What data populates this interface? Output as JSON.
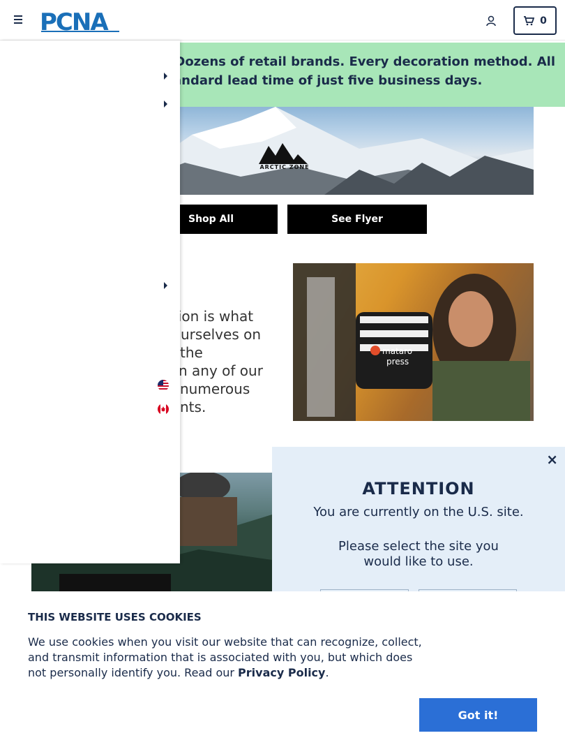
{
  "header": {
    "logo_text": "PCNA",
    "cart_count": "0"
  },
  "announcement": {
    "line1": "roducts. Dozens of retail brands. Every decoration method. All",
    "line2": "andard lead time of just five business days."
  },
  "banner": {
    "brand": "ARCTIC ZONE",
    "shop_all_label": "Shop All",
    "see_flyer_label": "See Flyer"
  },
  "feature": {
    "text_lines": [
      "tion is what",
      "urselves on",
      "the",
      "n any of our",
      "numerous",
      "nts."
    ],
    "product_label_1": "mataro",
    "product_label_2": "press"
  },
  "attention": {
    "title": "ATTENTION",
    "line1": "You are currently on the U.S. site.",
    "line2": "Please select the site you",
    "line3": "would like to use.",
    "close_label": "×"
  },
  "cookie": {
    "title": "THIS WEBSITE USES COOKIES",
    "body": "We use cookies when you visit our website that can recognize, collect, and transmit information that is associated with you, but which does not personally identify you. Read our ",
    "link_label": "Privacy Policy",
    "period": ".",
    "button_label": "Got it!"
  },
  "colors": {
    "navy": "#1a2b4a",
    "announcement_bg": "#a8e6b8",
    "attention_bg": "#e4eef8",
    "accept_button": "#2b6fd6"
  },
  "icons": [
    "hamburger-icon",
    "user-icon",
    "cart-icon",
    "caret-right-icon",
    "us-flag-icon",
    "canada-flag-icon",
    "close-icon"
  ]
}
